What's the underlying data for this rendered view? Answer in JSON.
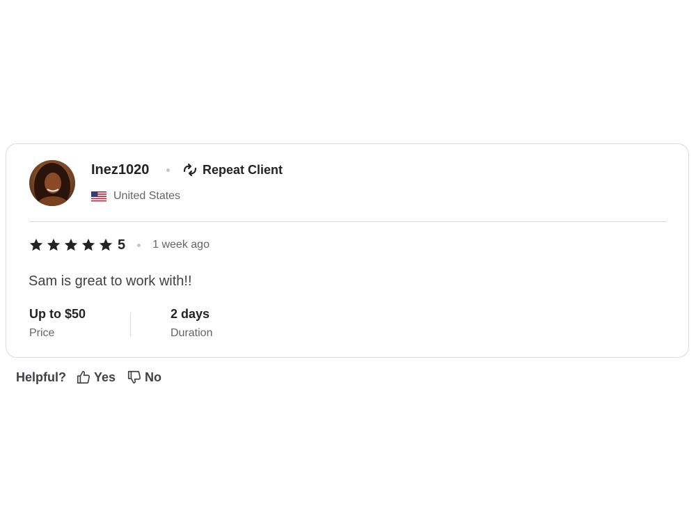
{
  "review": {
    "reviewer": {
      "name": "Inez1020",
      "badge_icon": "repeat-icon",
      "badge_label": "Repeat Client",
      "country_flag_icon": "us-flag-icon",
      "country": "United States",
      "avatar_icon": "avatar-photo"
    },
    "rating": {
      "stars_filled": 5,
      "stars_total": 5,
      "value": "5",
      "star_color": "#222325"
    },
    "time_ago": "1 week ago",
    "text": "Sam is great to work with!!",
    "stats": {
      "price_value": "Up to $50",
      "price_label": "Price",
      "duration_value": "2 days",
      "duration_label": "Duration"
    }
  },
  "helpful": {
    "label": "Helpful?",
    "yes_label": "Yes",
    "yes_icon": "thumbs-up-icon",
    "no_label": "No",
    "no_icon": "thumbs-down-icon"
  },
  "colors": {
    "text_primary": "#222325",
    "text_secondary": "#62646a",
    "border": "#dadbdd"
  }
}
